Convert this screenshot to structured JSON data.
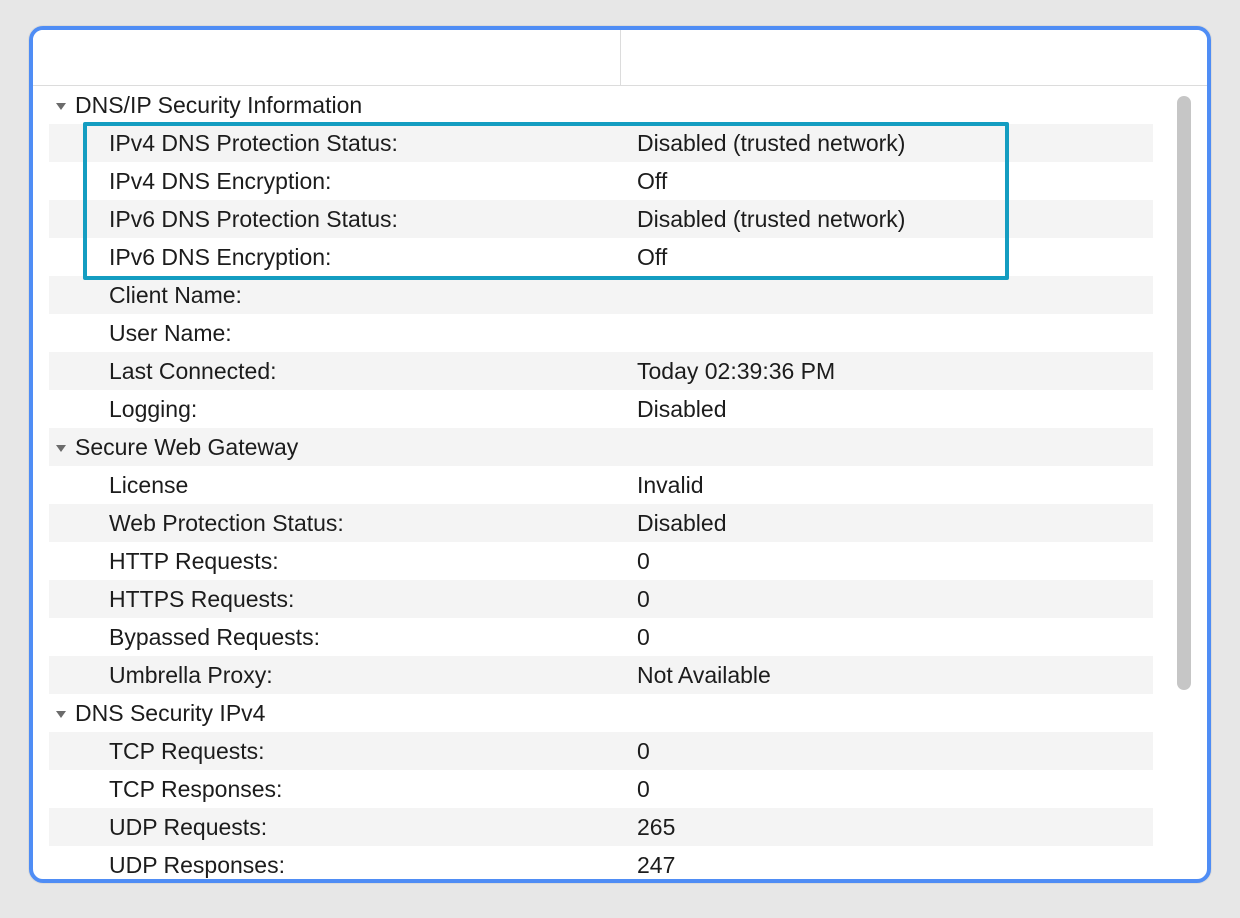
{
  "sections": [
    {
      "title": "DNS/IP Security Information",
      "rows": [
        {
          "label": "IPv4 DNS Protection Status:",
          "value": "Disabled (trusted network)"
        },
        {
          "label": "IPv4 DNS Encryption:",
          "value": "Off"
        },
        {
          "label": "IPv6 DNS Protection Status:",
          "value": "Disabled (trusted network)"
        },
        {
          "label": "IPv6 DNS Encryption:",
          "value": "Off"
        },
        {
          "label": "Client Name:",
          "value": ""
        },
        {
          "label": "User Name:",
          "value": ""
        },
        {
          "label": "Last Connected:",
          "value": "Today 02:39:36 PM"
        },
        {
          "label": "Logging:",
          "value": "Disabled"
        }
      ]
    },
    {
      "title": "Secure Web Gateway",
      "rows": [
        {
          "label": "License",
          "value": "Invalid"
        },
        {
          "label": "Web Protection Status:",
          "value": "Disabled"
        },
        {
          "label": "HTTP Requests:",
          "value": "0"
        },
        {
          "label": "HTTPS Requests:",
          "value": "0"
        },
        {
          "label": "Bypassed Requests:",
          "value": "0"
        },
        {
          "label": "Umbrella Proxy:",
          "value": "Not Available"
        }
      ]
    },
    {
      "title": "DNS Security IPv4",
      "rows": [
        {
          "label": "TCP Requests:",
          "value": "0"
        },
        {
          "label": "TCP Responses:",
          "value": "0"
        },
        {
          "label": "UDP Requests:",
          "value": "265"
        },
        {
          "label": "UDP Responses:",
          "value": "247"
        }
      ]
    }
  ],
  "highlight": {
    "section_index": 0,
    "from_row": 0,
    "to_row": 3
  }
}
